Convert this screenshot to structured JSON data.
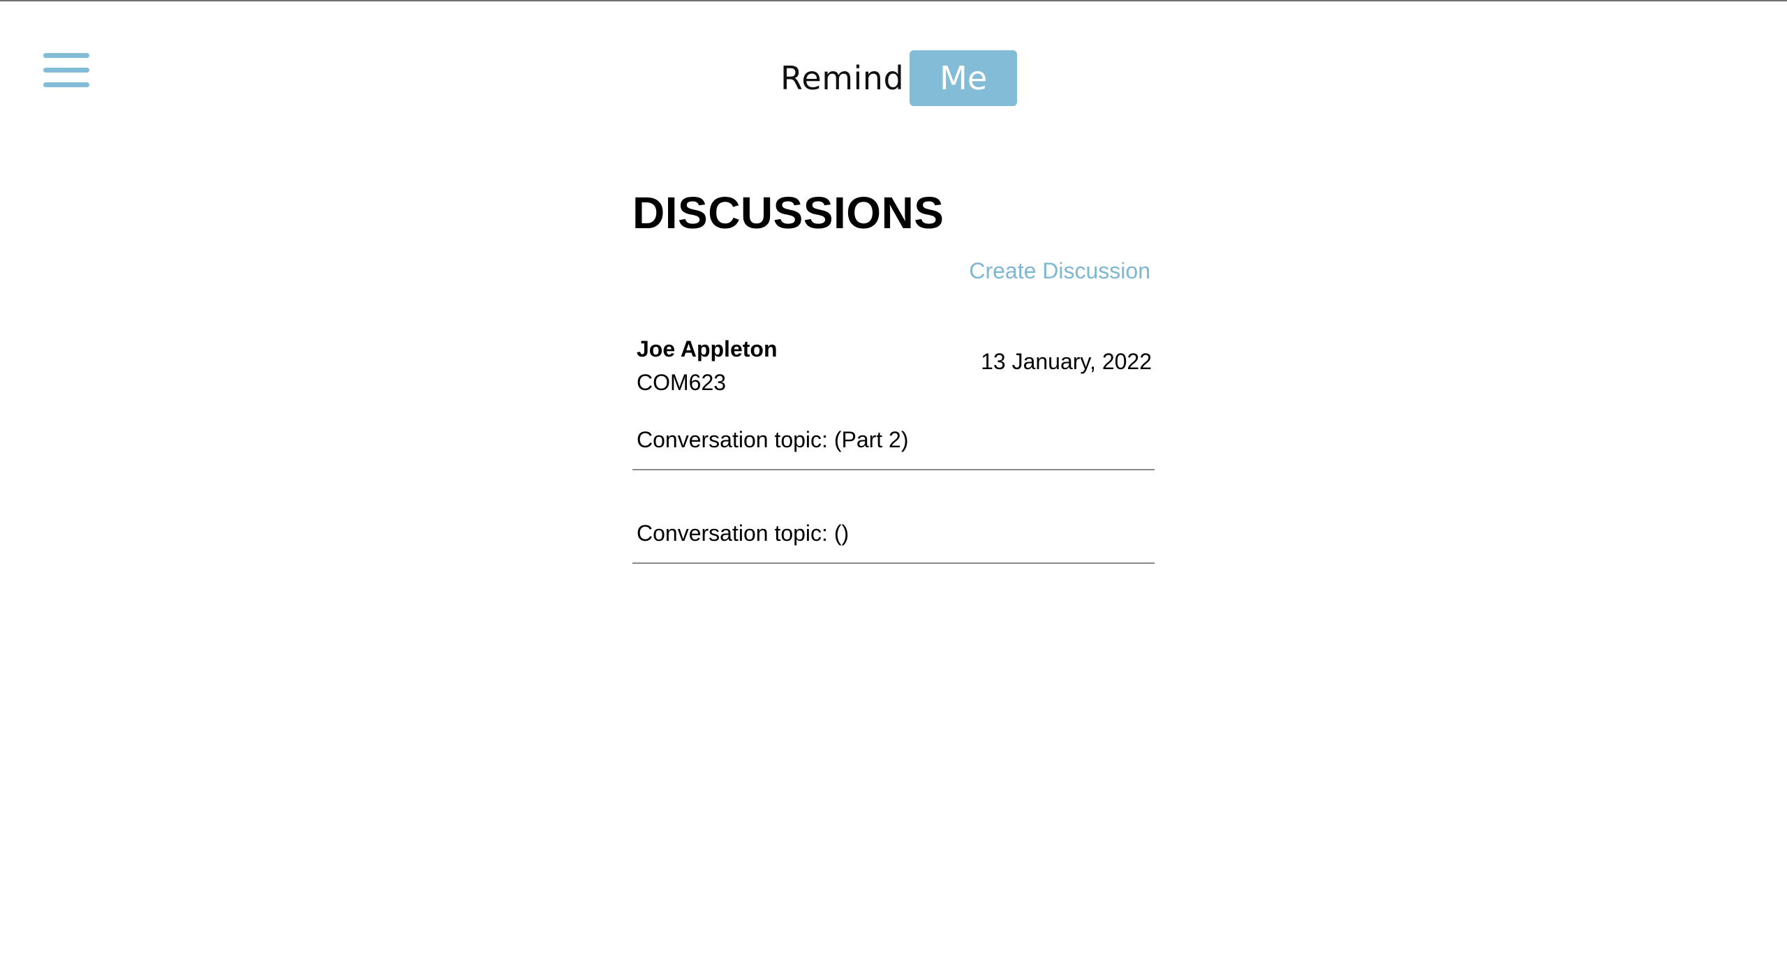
{
  "header": {
    "logo_left": "Remind",
    "logo_right": "Me",
    "menu_icon": "hamburger-menu-icon"
  },
  "colors": {
    "accent": "#82bcd6",
    "link": "#7db7d2",
    "divider": "#8a8a8a"
  },
  "main": {
    "title": "DISCUSSIONS",
    "create_label": "Create Discussion",
    "discussions": [
      {
        "author": "Joe Appleton",
        "course": "COM623",
        "date": "13 January, 2022",
        "topic": "Conversation topic: (Part 2)"
      },
      {
        "topic": "Conversation topic: ()"
      }
    ]
  }
}
